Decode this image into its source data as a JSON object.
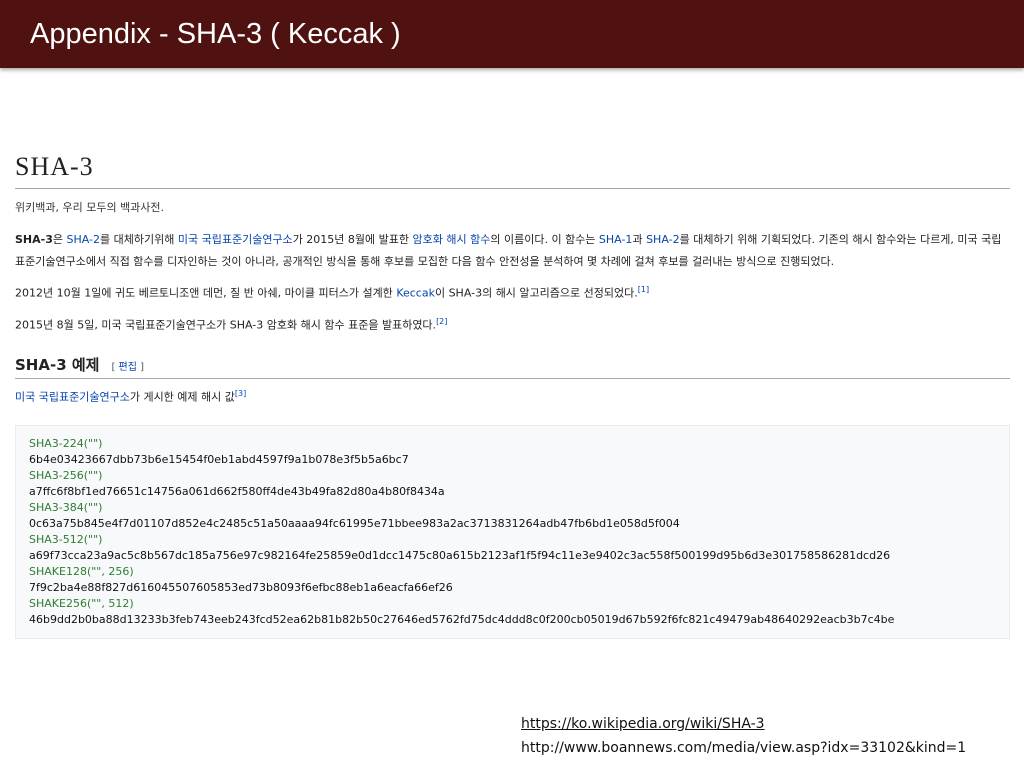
{
  "slide": {
    "title": "Appendix -  SHA-3 ( Keccak )"
  },
  "wiki": {
    "heading": "SHA-3",
    "tagline": "위키백과, 우리 모두의 백과사전.",
    "p1": {
      "t1": "SHA-3",
      "t2": "은 ",
      "t3": "SHA-2",
      "t4": "를 대체하기위해 ",
      "t5": "미국 국립표준기술연구소",
      "t6": "가 2015년 8월에 발표한 ",
      "t7": "암호화 해시 함수",
      "t8": "의 이름이다. 이 함수는 ",
      "t9": "SHA-1",
      "t10": "과 ",
      "t11": "SHA-2",
      "t12": "를 대체하기 위해 기획되었다. 기존의 해시 함수와는 다르게, 미국 국립표준기술연구소에서 직접 함수를 디자인하는 것이 아니라, 공개적인 방식을 통해 후보를 모집한 다음 함수 안전성을 분석하여 몇 차례에 걸쳐 후보를 걸러내는 방식으로 진행되었다."
    },
    "p2": {
      "t1": "2012년 10월 1일에 귀도 베르토니조앤 데먼, 질 반 아쉐, 마이클 피터스가 설계한 ",
      "t2": "Keccak",
      "t3": "이 SHA-3의 해시 알고리즘으로 선정되었다.",
      "ref": "[1]"
    },
    "p3": {
      "t1": "2015년 8월 5일, 미국 국립표준기술연구소가 SHA-3 암호화 해시 함수 표준을 발표하였다.",
      "ref": "[2]"
    },
    "section": {
      "heading": "SHA-3 예제",
      "edit_open": "[ ",
      "edit_label": "편집",
      "edit_close": " ]"
    },
    "p4": {
      "t1": "미국 국립표준기술연구소",
      "t2": "가 게시한 예제 해시 값",
      "ref": "[3]"
    },
    "hashes": [
      {
        "name": "SHA3-224(\"\")",
        "value": "6b4e03423667dbb73b6e15454f0eb1abd4597f9a1b078e3f5b5a6bc7"
      },
      {
        "name": "SHA3-256(\"\")",
        "value": "a7ffc6f8bf1ed76651c14756a061d662f580ff4de43b49fa82d80a4b80f8434a"
      },
      {
        "name": "SHA3-384(\"\")",
        "value": "0c63a75b845e4f7d01107d852e4c2485c51a50aaaa94fc61995e71bbee983a2ac3713831264adb47fb6bd1e058d5f004"
      },
      {
        "name": "SHA3-512(\"\")",
        "value": "a69f73cca23a9ac5c8b567dc185a756e97c982164fe25859e0d1dcc1475c80a615b2123af1f5f94c11e3e9402c3ac558f500199d95b6d3e301758586281dcd26"
      },
      {
        "name": "SHAKE128(\"\", 256)",
        "value": "7f9c2ba4e88f827d616045507605853ed73b8093f6efbc88eb1a6eacfa66ef26"
      },
      {
        "name": "SHAKE256(\"\", 512)",
        "value": "46b9dd2b0ba88d13233b3feb743eeb243fcd52ea62b81b82b50c27646ed5762fd75dc4ddd8c0f200cb05019d67b592f6fc821c49479ab48640292eacb3b7c4be"
      }
    ]
  },
  "sources": {
    "url1": "https://ko.wikipedia.org/wiki/SHA-3",
    "url2": "http://www.boannews.com/media/view.asp?idx=33102&kind=1"
  }
}
